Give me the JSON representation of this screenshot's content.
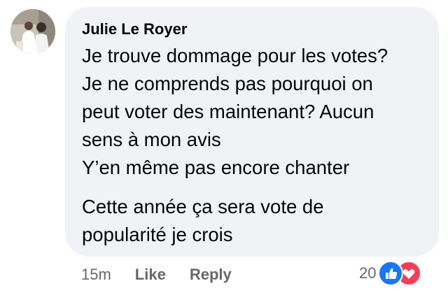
{
  "comment": {
    "author": "Julie Le Royer",
    "avatar_icon": "profile-photo-icon",
    "paragraphs": [
      {
        "lines": [
          "Je trouve dommage pour les votes?",
          "Je ne comprends pas pourquoi on",
          "peut voter des maintenant? Aucun",
          "sens à mon avis",
          "Y’en même pas encore chanter"
        ]
      },
      {
        "lines": [
          "Cette année ça sera vote de",
          "popularité je crois"
        ]
      }
    ]
  },
  "actions": {
    "timestamp": "15m",
    "like_label": "Like",
    "reply_label": "Reply"
  },
  "reactions": {
    "count": "20",
    "icons": [
      "like-reaction-icon",
      "love-reaction-icon"
    ],
    "like_color": "#1877f2",
    "love_color": "#f33e58"
  },
  "colors": {
    "bubble_bg": "#f0f2f5",
    "text": "#050505",
    "secondary_text": "#65676b"
  }
}
